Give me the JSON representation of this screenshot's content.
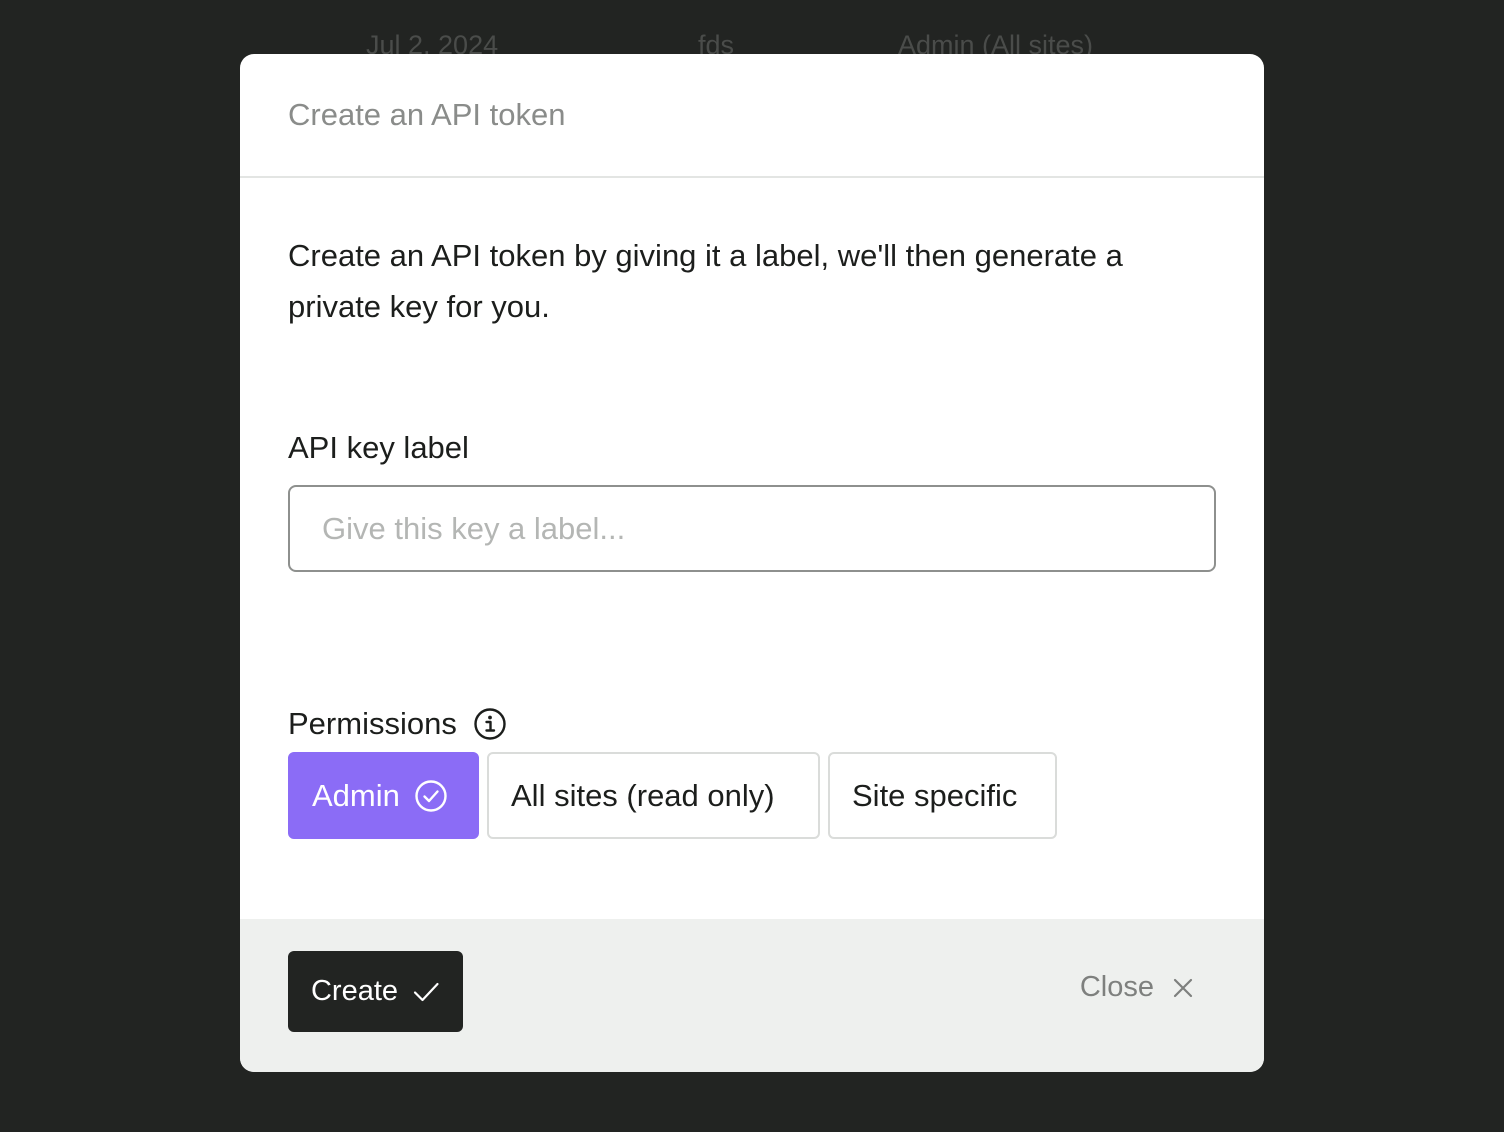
{
  "background_table": {
    "date": "Jul 2, 2024",
    "label": "fds",
    "permission": "Admin (All sites)"
  },
  "modal": {
    "title": "Create an API token",
    "description": "Create an API token by giving it a label, we'll then generate a private key for you.",
    "api_key_field": {
      "label": "API key label",
      "value": "",
      "placeholder": "Give this key a label..."
    },
    "permissions": {
      "label": "Permissions",
      "info_icon": "info-icon",
      "options": [
        {
          "label": "Admin",
          "selected": true,
          "icon": "check-circle-icon"
        },
        {
          "label": "All sites (read only)",
          "selected": false
        },
        {
          "label": "Site specific",
          "selected": false
        }
      ]
    },
    "footer": {
      "create_label": "Create",
      "create_icon": "checkmark-icon",
      "close_label": "Close",
      "close_icon": "close-icon"
    }
  },
  "colors": {
    "backdrop": "#222422",
    "accent": "#8b6cf6",
    "primary_button": "#222422",
    "footer_bg": "#eef0ee"
  }
}
